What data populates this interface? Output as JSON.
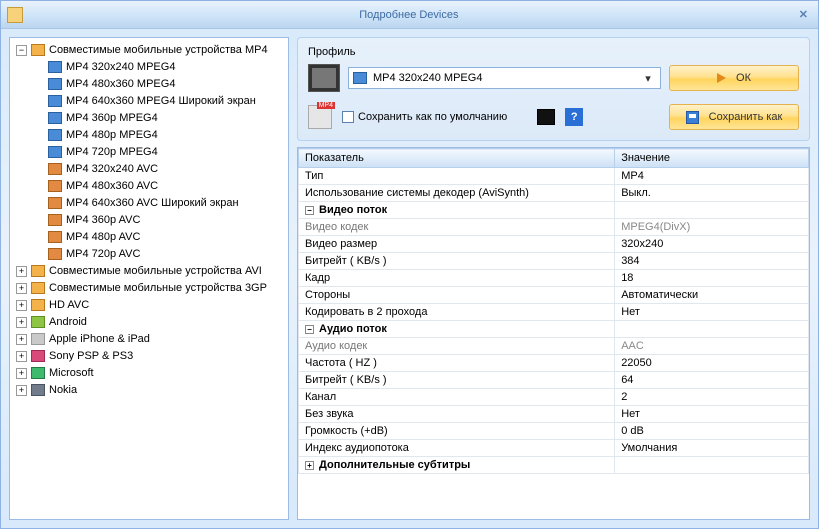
{
  "window": {
    "title": "Подробнее Devices"
  },
  "tree": {
    "top": [
      {
        "label": "Совместимые мобильные устройства MP4",
        "icon": "fi-device",
        "toggle": "−",
        "expanded": true
      },
      {
        "label": "Совместимые мобильные устройства AVI",
        "icon": "fi-device",
        "toggle": "+"
      },
      {
        "label": "Совместимые мобильные устройства 3GP",
        "icon": "fi-device",
        "toggle": "+"
      },
      {
        "label": "HD AVC",
        "icon": "fi-device",
        "toggle": "+"
      },
      {
        "label": "Android",
        "icon": "fi-android",
        "toggle": "+"
      },
      {
        "label": "Apple iPhone & iPad",
        "icon": "fi-apple",
        "toggle": "+"
      },
      {
        "label": "Sony PSP & PS3",
        "icon": "fi-sony",
        "toggle": "+"
      },
      {
        "label": "Microsoft",
        "icon": "fi-ms",
        "toggle": "+"
      },
      {
        "label": "Nokia",
        "icon": "fi-nokia",
        "toggle": "+"
      }
    ],
    "mp4_children": [
      {
        "label": "MP4 320x240 MPEG4",
        "icon": "fi-mp4"
      },
      {
        "label": "MP4 480x360 MPEG4",
        "icon": "fi-mp4"
      },
      {
        "label": "MP4 640x360 MPEG4 Широкий экран",
        "icon": "fi-mp4"
      },
      {
        "label": "MP4 360p MPEG4",
        "icon": "fi-mp4"
      },
      {
        "label": "MP4 480p MPEG4",
        "icon": "fi-mp4"
      },
      {
        "label": "MP4 720p MPEG4",
        "icon": "fi-mp4"
      },
      {
        "label": "MP4 320x240 AVC",
        "icon": "fi-avi"
      },
      {
        "label": "MP4 480x360 AVC",
        "icon": "fi-avi"
      },
      {
        "label": "MP4 640x360 AVC Широкий экран",
        "icon": "fi-avi"
      },
      {
        "label": "MP4 360p AVC",
        "icon": "fi-avi"
      },
      {
        "label": "MP4 480p AVC",
        "icon": "fi-avi"
      },
      {
        "label": "MP4 720p AVC",
        "icon": "fi-avi"
      }
    ]
  },
  "profile": {
    "legend": "Профиль",
    "selected": "MP4 320x240 MPEG4",
    "save_default_label": "Сохранить как по умолчанию",
    "ok_label": "ОК",
    "save_as_label": "Сохранить как",
    "help": "?"
  },
  "table": {
    "header_key": "Показатель",
    "header_val": "Значение",
    "rows": [
      {
        "type": "plain",
        "key": "Тип",
        "val": "MP4"
      },
      {
        "type": "plain",
        "key": "Использование системы декодер (AviSynth)",
        "val": "Выкл."
      },
      {
        "type": "group",
        "key": "Видео поток",
        "toggle": "−"
      },
      {
        "type": "sub",
        "key": "Видео кодек",
        "val": "MPEG4(DivX)",
        "muted": true
      },
      {
        "type": "sub",
        "key": "Видео размер",
        "val": "320x240"
      },
      {
        "type": "sub",
        "key": "Битрейт ( KB/s )",
        "val": "384"
      },
      {
        "type": "sub",
        "key": "Кадр",
        "val": "18"
      },
      {
        "type": "sub",
        "key": "Стороны",
        "val": "Автоматически"
      },
      {
        "type": "sub",
        "key": "Кодировать в 2 прохода",
        "val": "Нет"
      },
      {
        "type": "group",
        "key": "Аудио поток",
        "toggle": "−"
      },
      {
        "type": "sub",
        "key": "Аудио кодек",
        "val": "AAC",
        "muted": true
      },
      {
        "type": "sub",
        "key": "Частота ( HZ )",
        "val": "22050"
      },
      {
        "type": "sub",
        "key": "Битрейт ( KB/s )",
        "val": "64"
      },
      {
        "type": "sub",
        "key": "Канал",
        "val": "2"
      },
      {
        "type": "sub",
        "key": "Без звука",
        "val": "Нет"
      },
      {
        "type": "sub",
        "key": "Громкость (+dB)",
        "val": "0 dB"
      },
      {
        "type": "sub",
        "key": "Индекс аудиопотока",
        "val": "Умолчания"
      },
      {
        "type": "group",
        "key": "Дополнительные субтитры",
        "toggle": "+"
      }
    ]
  }
}
